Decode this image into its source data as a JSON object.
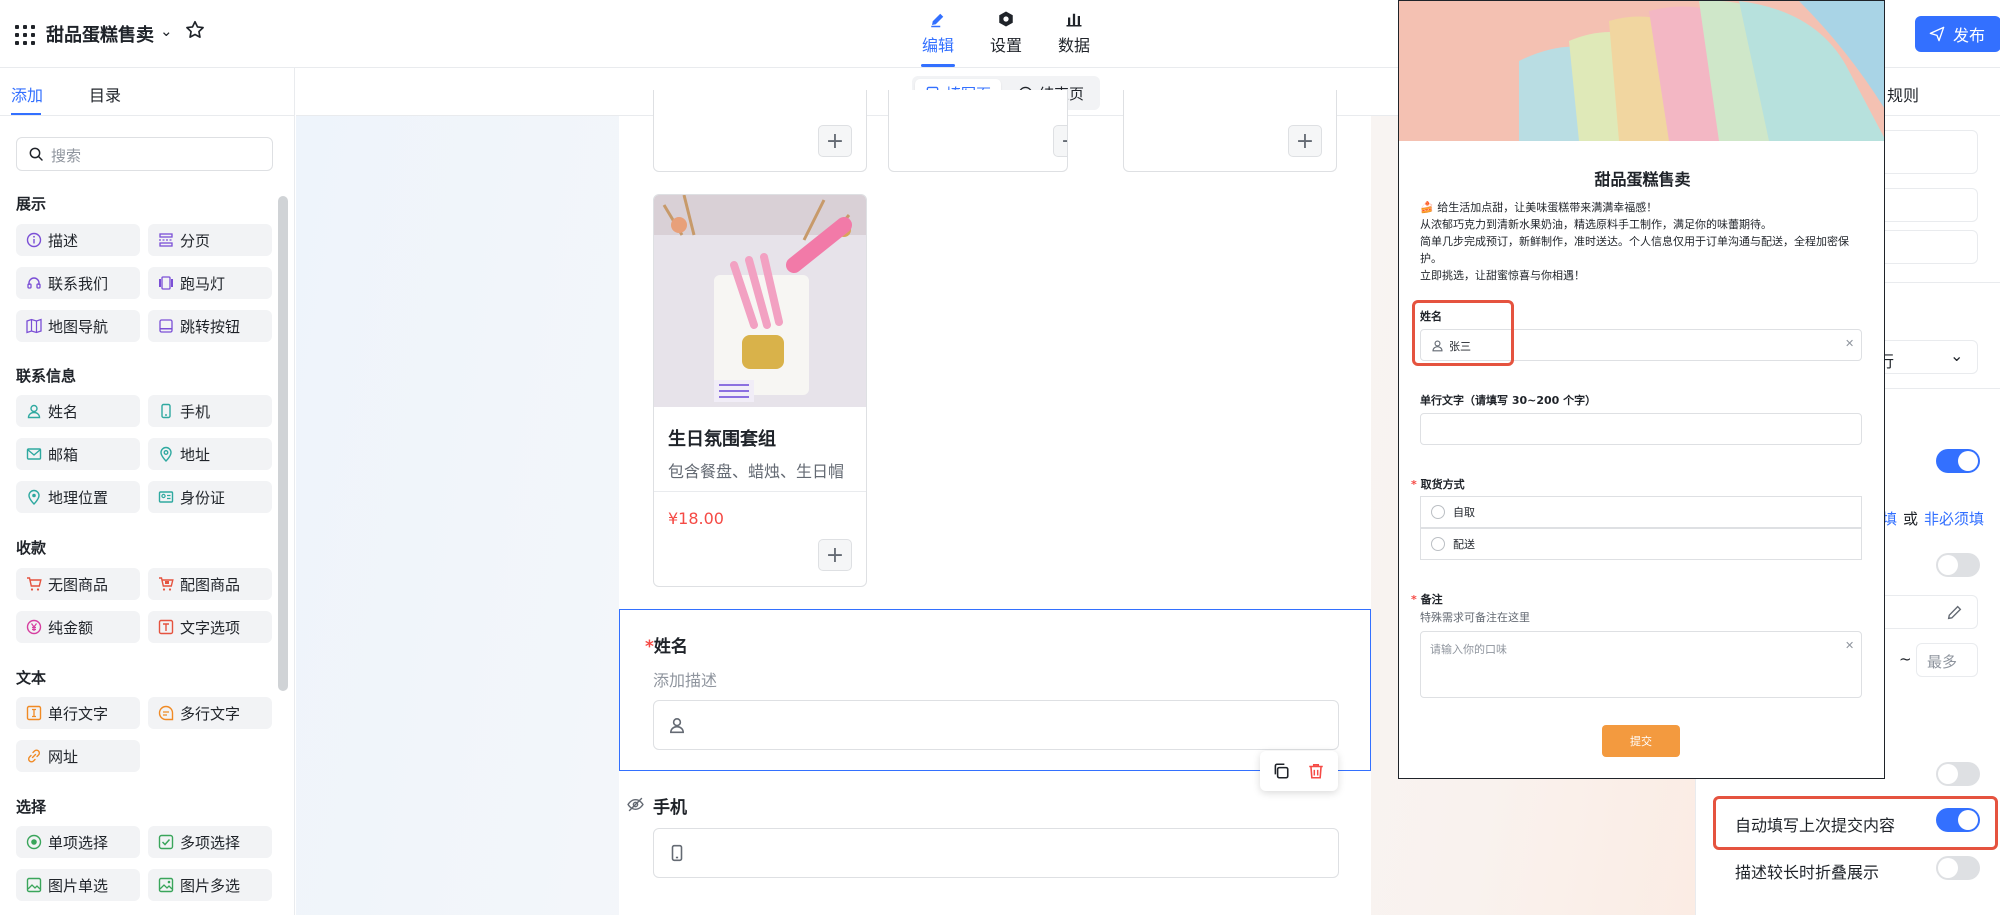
{
  "app": {
    "title": "甜品蛋糕售卖",
    "publish_label": "发布",
    "tabs": [
      {
        "label": "编辑",
        "active": true
      },
      {
        "label": "设置",
        "active": false
      },
      {
        "label": "数据",
        "active": false
      }
    ]
  },
  "left_panel": {
    "tabs": [
      "添加",
      "目录"
    ],
    "search_placeholder": "搜索",
    "sections": [
      {
        "title": "展示",
        "items": [
          {
            "label": "描述",
            "icon": "info-icon"
          },
          {
            "label": "分页",
            "icon": "pagination-icon"
          },
          {
            "label": "联系我们",
            "icon": "headset-icon"
          },
          {
            "label": "跑马灯",
            "icon": "carousel-icon"
          },
          {
            "label": "地图导航",
            "icon": "map-icon"
          },
          {
            "label": "跳转按钮",
            "icon": "jump-button-icon"
          }
        ]
      },
      {
        "title": "联系信息",
        "items": [
          {
            "label": "姓名",
            "icon": "person-icon"
          },
          {
            "label": "手机",
            "icon": "phone-icon"
          },
          {
            "label": "邮箱",
            "icon": "mail-icon"
          },
          {
            "label": "地址",
            "icon": "location-pin-icon"
          },
          {
            "label": "地理位置",
            "icon": "geo-icon"
          },
          {
            "label": "身份证",
            "icon": "id-card-icon"
          }
        ]
      },
      {
        "title": "收款",
        "items": [
          {
            "label": "无图商品",
            "icon": "cart-icon"
          },
          {
            "label": "配图商品",
            "icon": "cart-image-icon"
          },
          {
            "label": "纯金额",
            "icon": "yen-icon"
          },
          {
            "label": "文字选项",
            "icon": "text-option-icon"
          }
        ]
      },
      {
        "title": "文本",
        "items": [
          {
            "label": "单行文字",
            "icon": "single-line-text-icon"
          },
          {
            "label": "多行文字",
            "icon": "multi-line-text-icon"
          },
          {
            "label": "网址",
            "icon": "link-icon"
          }
        ]
      },
      {
        "title": "选择",
        "items": [
          {
            "label": "单项选择",
            "icon": "radio-icon"
          },
          {
            "label": "多项选择",
            "icon": "checkbox-icon"
          },
          {
            "label": "图片单选",
            "icon": "image-radio-icon"
          },
          {
            "label": "图片多选",
            "icon": "image-checkbox-icon"
          }
        ]
      }
    ]
  },
  "canvas": {
    "page_tabs": [
      "填写页",
      "结束页"
    ],
    "product": {
      "name": "生日氛围套组",
      "desc": "包含餐盘、蜡烛、生日帽",
      "price": "¥18.00"
    },
    "name_field": {
      "label": "姓名",
      "desc_placeholder": "添加描述"
    },
    "phone_field": {
      "label": "手机"
    }
  },
  "preview": {
    "title": "甜品蛋糕售卖",
    "desc_lines": [
      "🍰 给生活加点甜，让美味蛋糕带来满满幸福感！",
      "从浓郁巧克力到清新水果奶油，精选原料手工制作，满足你的味蕾期待。",
      "简单几步完成预订，新鲜制作，准时送达。个人信息仅用于订单沟通与配送，全程加密保护。",
      "立即挑选，让甜蜜惊喜与你相遇！"
    ],
    "name_label": "姓名",
    "name_value": "张三",
    "single_text_label": "单行文字（请填写 30~200 个字）",
    "pickup_label": "取货方式",
    "pickup_options": [
      "自取",
      "配送"
    ],
    "note_label": "备注",
    "note_hint": "特殊需求可备注在这里",
    "note_placeholder": "请输入你的口味",
    "submit_label": "提交"
  },
  "right_panel": {
    "tab_partial": "规则",
    "select_partial": "行",
    "required_text": {
      "left": "填",
      "or": "或",
      "right": "非必须填"
    },
    "range_max_placeholder": "最多",
    "range_sep": "~",
    "autofill_label": "自动填写上次提交内容",
    "collapse_label": "描述较长时折叠展示"
  },
  "colors": {
    "accent": "#3370ff",
    "highlight": "#e5533f",
    "price": "#f54a45",
    "submit": "#f39a3f"
  }
}
